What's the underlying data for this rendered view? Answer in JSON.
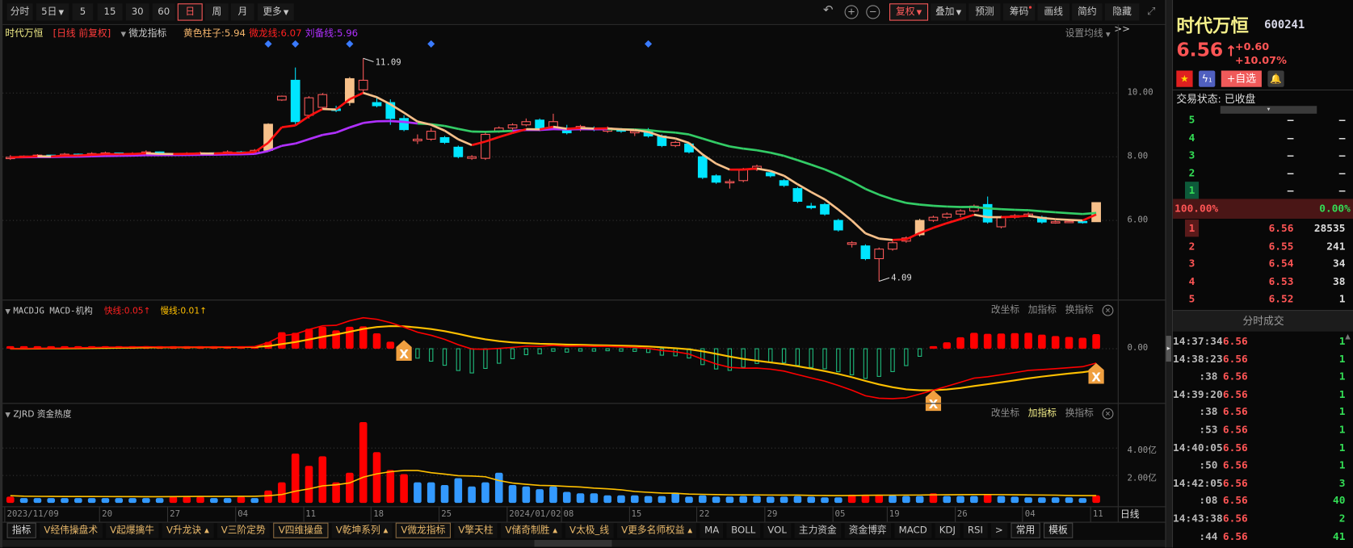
{
  "toolbar": {
    "periods": [
      {
        "label": "分时"
      },
      {
        "label": "5日",
        "caret": true
      },
      {
        "label": "5"
      },
      {
        "label": "15"
      },
      {
        "label": "30"
      },
      {
        "label": "60"
      },
      {
        "label": "日",
        "active": true
      },
      {
        "label": "周"
      },
      {
        "label": "月"
      },
      {
        "label": "更多",
        "caret": true
      }
    ],
    "icons": [
      "undo-icon",
      "zoom-in-icon",
      "zoom-out-icon"
    ],
    "right_buttons": [
      {
        "label": "复权",
        "caret": true,
        "active": true
      },
      {
        "label": "叠加",
        "caret": true
      },
      {
        "label": "预测"
      },
      {
        "label": "筹码",
        "dot": true
      },
      {
        "label": "画线"
      },
      {
        "label": "简约"
      },
      {
        "label": "隐藏>>"
      }
    ]
  },
  "main": {
    "stock_name": "时代万恒",
    "period_label": "[日线  前复权]",
    "indicator": "微龙指标",
    "legend": [
      {
        "label": "黄色柱子:5.94",
        "color": "#f2b36b"
      },
      {
        "label": "微龙线:6.07",
        "color": "#ff2020"
      },
      {
        "label": "刘备线:5.96",
        "color": "#b030ff"
      }
    ],
    "set_ma": "设置均线",
    "axis": [
      "10.00",
      "8.00",
      "6.00"
    ],
    "high_label": "11.09",
    "low_label": "4.09"
  },
  "macd": {
    "title": "MACDJG MACD-机构",
    "fast": "快线:0.05↑",
    "slow": "慢线:0.01↑",
    "axis": "0.00",
    "actions": [
      "改坐标",
      "加指标",
      "换指标"
    ]
  },
  "zjrd": {
    "title": "ZJRD 资金热度",
    "axis": [
      "4.00亿",
      "2.00亿"
    ],
    "actions": [
      "改坐标",
      "加指标",
      "换指标"
    ]
  },
  "dates": [
    "2023/11/09",
    "20",
    "27",
    "04",
    "11",
    "18",
    "25",
    "2024/01/02",
    "08",
    "15",
    "22",
    "29",
    "05",
    "19",
    "26",
    "04",
    "11"
  ],
  "date_unit": "日线",
  "tabs": [
    {
      "label": "指标",
      "kind": "first"
    },
    {
      "label": "V经伟操盘术"
    },
    {
      "label": "V起爆擒牛"
    },
    {
      "label": "V升龙诀 ▴"
    },
    {
      "label": "V三阶定势"
    },
    {
      "label": "V四维操盘",
      "kind": "boxed"
    },
    {
      "label": "V乾坤系列 ▴"
    },
    {
      "label": "V微龙指标",
      "kind": "boxed"
    },
    {
      "label": "V擎天柱"
    },
    {
      "label": "V储奇制胜 ▴"
    },
    {
      "label": "V太极_线"
    },
    {
      "label": "V更多名师权益 ▴"
    },
    {
      "label": "MA",
      "kind": "plain"
    },
    {
      "label": "BOLL",
      "kind": "plain"
    },
    {
      "label": "VOL",
      "kind": "plain"
    },
    {
      "label": "主力资金",
      "kind": "plain"
    },
    {
      "label": "资金博弈",
      "kind": "plain"
    },
    {
      "label": "MACD",
      "kind": "plain"
    },
    {
      "label": "KDJ",
      "kind": "plain"
    },
    {
      "label": "RSI",
      "kind": "plain"
    },
    {
      "label": ">",
      "kind": "plain"
    },
    {
      "label": "常用",
      "kind": "first"
    },
    {
      "label": "模板",
      "kind": "first"
    }
  ],
  "quote": {
    "name": "时代万恒",
    "code": "600241",
    "price": "6.56",
    "arrow": "↑",
    "change": "+0.60",
    "pct": "+10.07%",
    "badge_count": "1",
    "watch": "+自选",
    "status": "交易状态: 已收盘",
    "sell": [
      {
        "lv": "5",
        "p": "—",
        "v": "—"
      },
      {
        "lv": "4",
        "p": "—",
        "v": "—"
      },
      {
        "lv": "3",
        "p": "—",
        "v": "—"
      },
      {
        "lv": "2",
        "p": "—",
        "v": "—"
      },
      {
        "lv": "1",
        "p": "—",
        "v": "—"
      }
    ],
    "ratio_left": "100.00%",
    "ratio_right": "0.00%",
    "buy": [
      {
        "lv": "1",
        "p": "6.56",
        "v": "28535"
      },
      {
        "lv": "2",
        "p": "6.55",
        "v": "241"
      },
      {
        "lv": "3",
        "p": "6.54",
        "v": "34"
      },
      {
        "lv": "4",
        "p": "6.53",
        "v": "38"
      },
      {
        "lv": "5",
        "p": "6.52",
        "v": "1"
      }
    ],
    "ticks_title": "分时成交",
    "ticks": [
      {
        "t": "14:37:34",
        "p": "6.56",
        "v": "1"
      },
      {
        "t": "14:38:23",
        "p": "6.56",
        "v": "1"
      },
      {
        "t": ":38",
        "p": "6.56",
        "v": "1"
      },
      {
        "t": "14:39:20",
        "p": "6.56",
        "v": "1"
      },
      {
        "t": ":38",
        "p": "6.56",
        "v": "1"
      },
      {
        "t": ":53",
        "p": "6.56",
        "v": "1"
      },
      {
        "t": "14:40:05",
        "p": "6.56",
        "v": "1"
      },
      {
        "t": ":50",
        "p": "6.56",
        "v": "1"
      },
      {
        "t": "14:42:05",
        "p": "6.56",
        "v": "3"
      },
      {
        "t": ":08",
        "p": "6.56",
        "v": "40"
      },
      {
        "t": "14:43:38",
        "p": "6.56",
        "v": "2"
      },
      {
        "t": ":44",
        "p": "6.56",
        "v": "41"
      }
    ]
  },
  "colors": {
    "up": "#ff5a5a",
    "down": "#00e5ff",
    "limit_up": "#f7c08a",
    "heat_up": "#ff0000",
    "heat_down": "#3399ff",
    "fast_line": "#ff0000",
    "slow_line": "#ffc000"
  },
  "chart_data": {
    "type": "candlestick",
    "price_range": [
      4,
      11.5
    ],
    "ohlc": [
      [
        7.95,
        8.05,
        7.9,
        7.98
      ],
      [
        7.98,
        8.04,
        7.96,
        8.02
      ],
      [
        8.02,
        8.08,
        8.0,
        8.05
      ],
      [
        8.05,
        8.06,
        7.98,
        8.0
      ],
      [
        8.0,
        8.12,
        7.99,
        8.08
      ],
      [
        8.08,
        8.1,
        8.02,
        8.05
      ],
      [
        8.05,
        8.14,
        8.03,
        8.1
      ],
      [
        8.1,
        8.16,
        8.08,
        8.12
      ],
      [
        8.12,
        8.13,
        8.05,
        8.08
      ],
      [
        8.08,
        8.14,
        8.06,
        8.1
      ],
      [
        8.1,
        8.2,
        8.08,
        8.15
      ],
      [
        8.15,
        8.16,
        8.03,
        8.05
      ],
      [
        8.05,
        8.12,
        8.03,
        8.08
      ],
      [
        8.08,
        8.14,
        8.06,
        8.1
      ],
      [
        8.1,
        8.16,
        8.08,
        8.12
      ],
      [
        8.12,
        8.14,
        8.06,
        8.1
      ],
      [
        8.1,
        8.2,
        8.08,
        8.15
      ],
      [
        8.15,
        8.18,
        8.1,
        8.12
      ],
      [
        8.12,
        8.24,
        8.1,
        8.2
      ],
      [
        8.2,
        9.05,
        8.2,
        9.02
      ],
      [
        9.78,
        9.92,
        9.75,
        9.9
      ],
      [
        10.4,
        10.8,
        9.0,
        9.1
      ],
      [
        9.3,
        9.9,
        9.2,
        9.85
      ],
      [
        9.55,
        10.0,
        9.5,
        9.95
      ],
      [
        9.5,
        9.6,
        9.4,
        9.45
      ],
      [
        9.7,
        10.5,
        9.6,
        10.45
      ],
      [
        10.1,
        11.09,
        10.0,
        10.4
      ],
      [
        9.7,
        9.9,
        9.55,
        9.6
      ],
      [
        9.7,
        9.8,
        9.0,
        9.2
      ],
      [
        9.2,
        9.3,
        8.8,
        8.85
      ],
      [
        8.5,
        8.7,
        8.4,
        8.55
      ],
      [
        8.55,
        8.9,
        8.5,
        8.8
      ],
      [
        8.6,
        8.65,
        8.4,
        8.45
      ],
      [
        8.3,
        8.35,
        7.95,
        8.0
      ],
      [
        7.95,
        8.05,
        7.9,
        8.0
      ],
      [
        7.95,
        8.8,
        7.9,
        8.7
      ],
      [
        8.8,
        8.95,
        8.75,
        8.9
      ],
      [
        8.9,
        9.05,
        8.85,
        9.0
      ],
      [
        9.0,
        9.2,
        8.95,
        9.1
      ],
      [
        9.15,
        9.2,
        8.8,
        8.85
      ],
      [
        8.9,
        9.35,
        8.85,
        9.1
      ],
      [
        8.9,
        9.0,
        8.7,
        8.75
      ],
      [
        8.85,
        9.0,
        8.8,
        8.95
      ],
      [
        8.9,
        8.95,
        8.8,
        8.85
      ],
      [
        8.8,
        8.95,
        8.75,
        8.9
      ],
      [
        8.85,
        8.9,
        8.75,
        8.8
      ],
      [
        8.75,
        8.85,
        8.65,
        8.8
      ],
      [
        8.8,
        8.9,
        8.6,
        8.65
      ],
      [
        8.65,
        8.7,
        8.3,
        8.35
      ],
      [
        8.35,
        8.5,
        8.3,
        8.45
      ],
      [
        8.4,
        8.45,
        8.1,
        8.15
      ],
      [
        8.0,
        8.05,
        7.3,
        7.35
      ],
      [
        7.4,
        7.45,
        7.15,
        7.2
      ],
      [
        7.2,
        7.3,
        7.0,
        7.22
      ],
      [
        7.25,
        7.65,
        7.2,
        7.6
      ],
      [
        7.6,
        7.75,
        7.55,
        7.7
      ],
      [
        7.5,
        7.55,
        7.35,
        7.4
      ],
      [
        7.25,
        7.3,
        7.05,
        7.1
      ],
      [
        7.0,
        7.05,
        6.55,
        6.6
      ],
      [
        6.45,
        6.55,
        6.35,
        6.4
      ],
      [
        6.5,
        6.55,
        6.15,
        6.2
      ],
      [
        6.0,
        6.05,
        5.65,
        5.7
      ],
      [
        5.25,
        5.35,
        5.15,
        5.3
      ],
      [
        5.2,
        5.25,
        4.75,
        4.8
      ],
      [
        4.8,
        5.15,
        4.09,
        5.1
      ],
      [
        5.1,
        5.35,
        5.05,
        5.3
      ],
      [
        5.35,
        5.5,
        5.3,
        5.45
      ],
      [
        5.55,
        6.05,
        5.5,
        6.0
      ],
      [
        6.0,
        6.15,
        5.95,
        6.1
      ],
      [
        6.1,
        6.25,
        6.05,
        6.2
      ],
      [
        6.2,
        6.35,
        6.1,
        6.3
      ],
      [
        6.3,
        6.5,
        6.25,
        6.45
      ],
      [
        6.5,
        6.75,
        5.9,
        5.95
      ],
      [
        5.8,
        6.15,
        5.75,
        6.1
      ],
      [
        6.1,
        6.2,
        6.05,
        6.15
      ],
      [
        6.15,
        6.25,
        6.1,
        6.2
      ],
      [
        6.1,
        6.15,
        5.9,
        5.95
      ],
      [
        5.95,
        6.0,
        5.9,
        5.96
      ],
      [
        5.96,
        6.0,
        5.92,
        5.97
      ],
      [
        5.97,
        6.0,
        5.9,
        5.96
      ],
      [
        5.96,
        6.56,
        5.96,
        6.56
      ]
    ],
    "heat_unit": "亿",
    "heat": [
      0.45,
      0.35,
      0.35,
      0.35,
      0.35,
      0.35,
      0.35,
      0.35,
      0.35,
      0.35,
      0.35,
      0.35,
      0.45,
      0.45,
      0.45,
      0.35,
      0.35,
      0.45,
      0.35,
      0.9,
      1.5,
      3.6,
      2.7,
      3.4,
      1.5,
      2.2,
      5.9,
      3.7,
      2.4,
      2.1,
      1.5,
      1.5,
      1.3,
      1.8,
      1.2,
      1.5,
      2.2,
      1.3,
      1.2,
      1.0,
      1.2,
      0.8,
      0.7,
      0.7,
      0.55,
      0.55,
      0.55,
      0.5,
      0.5,
      0.75,
      0.45,
      0.55,
      0.45,
      0.45,
      0.5,
      0.5,
      0.45,
      0.45,
      0.5,
      0.45,
      0.4,
      0.4,
      0.6,
      0.6,
      0.6,
      0.55,
      0.5,
      0.5,
      0.7,
      0.5,
      0.5,
      0.5,
      0.65,
      0.5,
      0.45,
      0.4,
      0.4,
      0.4,
      0.4,
      0.35,
      0.55
    ],
    "heat_up_days": [
      0,
      12,
      13,
      14,
      17,
      19,
      20,
      21,
      22,
      23,
      24,
      25,
      26,
      27,
      28,
      29,
      62,
      63,
      64,
      68,
      72,
      80
    ]
  }
}
